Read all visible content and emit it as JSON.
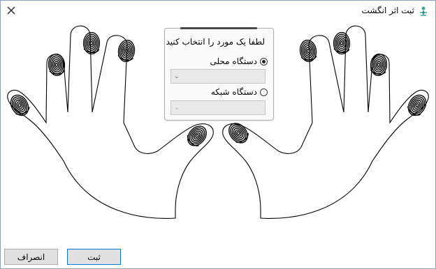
{
  "window": {
    "title": "ثبت اثر انگشت",
    "icon": "fingerprint-app-icon"
  },
  "panel": {
    "title": "لطفا یک مورد را انتخاب کنید",
    "options": [
      {
        "label": "دستگاه محلی",
        "selected": true
      },
      {
        "label": "دستگاه شبکه",
        "selected": false
      }
    ],
    "local_device_value": "",
    "network_device_value": ""
  },
  "buttons": {
    "cancel": "انصراف",
    "submit": "ثبت"
  },
  "colors": {
    "window_border": "#8aa0b8",
    "button_face": "#e1e1e1",
    "focus_border": "#0078d7",
    "app_icon": "#3aa7a0"
  }
}
